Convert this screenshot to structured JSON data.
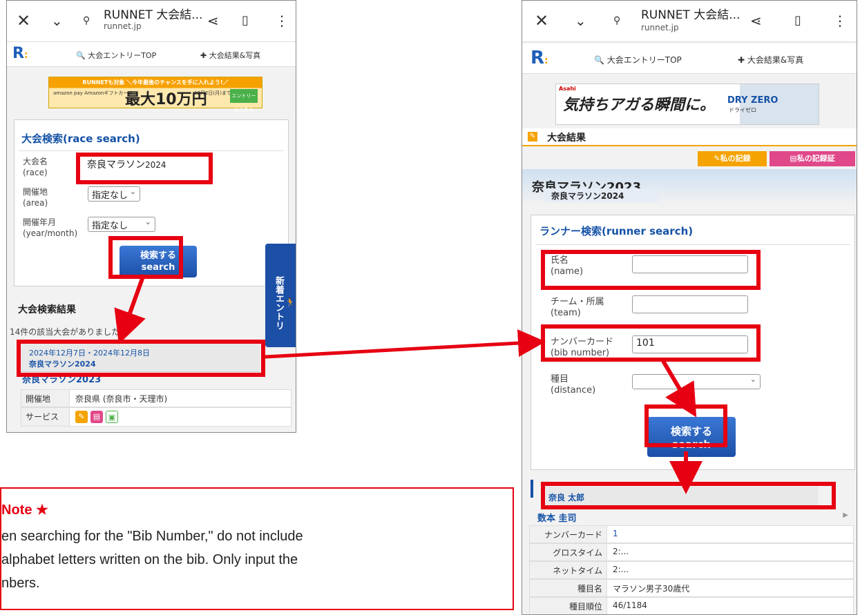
{
  "browser": {
    "title": "RUNNET 大会結...",
    "domain": "runnet.jp"
  },
  "nav": {
    "logo": "R",
    "entry_top": "大会エントリーTOP",
    "results_photos": "大会結果&写真"
  },
  "ad_left": {
    "top_text": "RUNNETも対象 ＼今年最後のチャンスを手に入れよう!／",
    "pay": "amazon pay Amazonギフトカード",
    "big": "最大10万円",
    "date": "12月2日(月)まで",
    "entry": "エントリーはこちら"
  },
  "ad_right": {
    "brand": "Asahi",
    "headline": "気持ちアガる瞬間に。",
    "product": "DRY ZERO",
    "product_sub": "ドライゼロ"
  },
  "race_search": {
    "title": "大会検索(race search)",
    "race_label_jp": "大会名",
    "race_label_en": "(race)",
    "race_value": "奈良マラソン",
    "race_value_suffix": "2024",
    "area_label_jp": "開催地",
    "area_label_en": "(area)",
    "area_value": "指定なし",
    "ym_label_jp": "開催年月",
    "ym_label_en": "(year/month)",
    "ym_value": "指定なし",
    "button_jp": "検索する",
    "button_en": "search"
  },
  "side_tab": "新着エントリ",
  "race_results": {
    "heading": "大会検索結果",
    "count_text": "14件の該当大会がありました。",
    "date": "2024年12月7日・2024年12月8日",
    "race_name": "奈良マラソン2024",
    "underlying_name": "奈良マラソン2023",
    "area_key": "開催地",
    "area_value": "奈良県 (奈良市・天理市)",
    "service_key": "サービス"
  },
  "right_page": {
    "section": "大会結果",
    "my_record": "私の記録",
    "my_cert": "私の記録証",
    "race_title": "奈良マラソン2023",
    "race_overlay": "奈良マラソン2024"
  },
  "runner_search": {
    "title": "ランナー検索(runner search)",
    "name_jp": "氏名",
    "name_en": "(name)",
    "team_jp": "チーム・所属",
    "team_en": "(team)",
    "bib_jp": "ナンバーカード",
    "bib_en": "(bib number)",
    "bib_value": "101",
    "dist_jp": "種目",
    "dist_en": "(distance)",
    "button_jp": "検索する",
    "button_en": "search"
  },
  "runner_result": {
    "name": "奈良 太郎",
    "underlying_name": "数本 圭司",
    "rows": [
      {
        "k": "ナンバーカード",
        "v": "1"
      },
      {
        "k": "グロスタイム",
        "v": "2:..."
      },
      {
        "k": "ネットタイム",
        "v": "2:..."
      },
      {
        "k": "種目名",
        "v": "マラソン男子30歳代"
      },
      {
        "k": "種目順位",
        "v": "46/1184"
      }
    ]
  },
  "note": {
    "title": "Note ★",
    "line1": "en searching for the \"Bib Number,\" do not include",
    "line2": "alphabet letters written on the bib. Only input the",
    "line3": "nbers."
  },
  "colors": {
    "brand_blue": "#1552a6",
    "highlight_red": "#e60012",
    "accent_orange": "#f5a300"
  }
}
